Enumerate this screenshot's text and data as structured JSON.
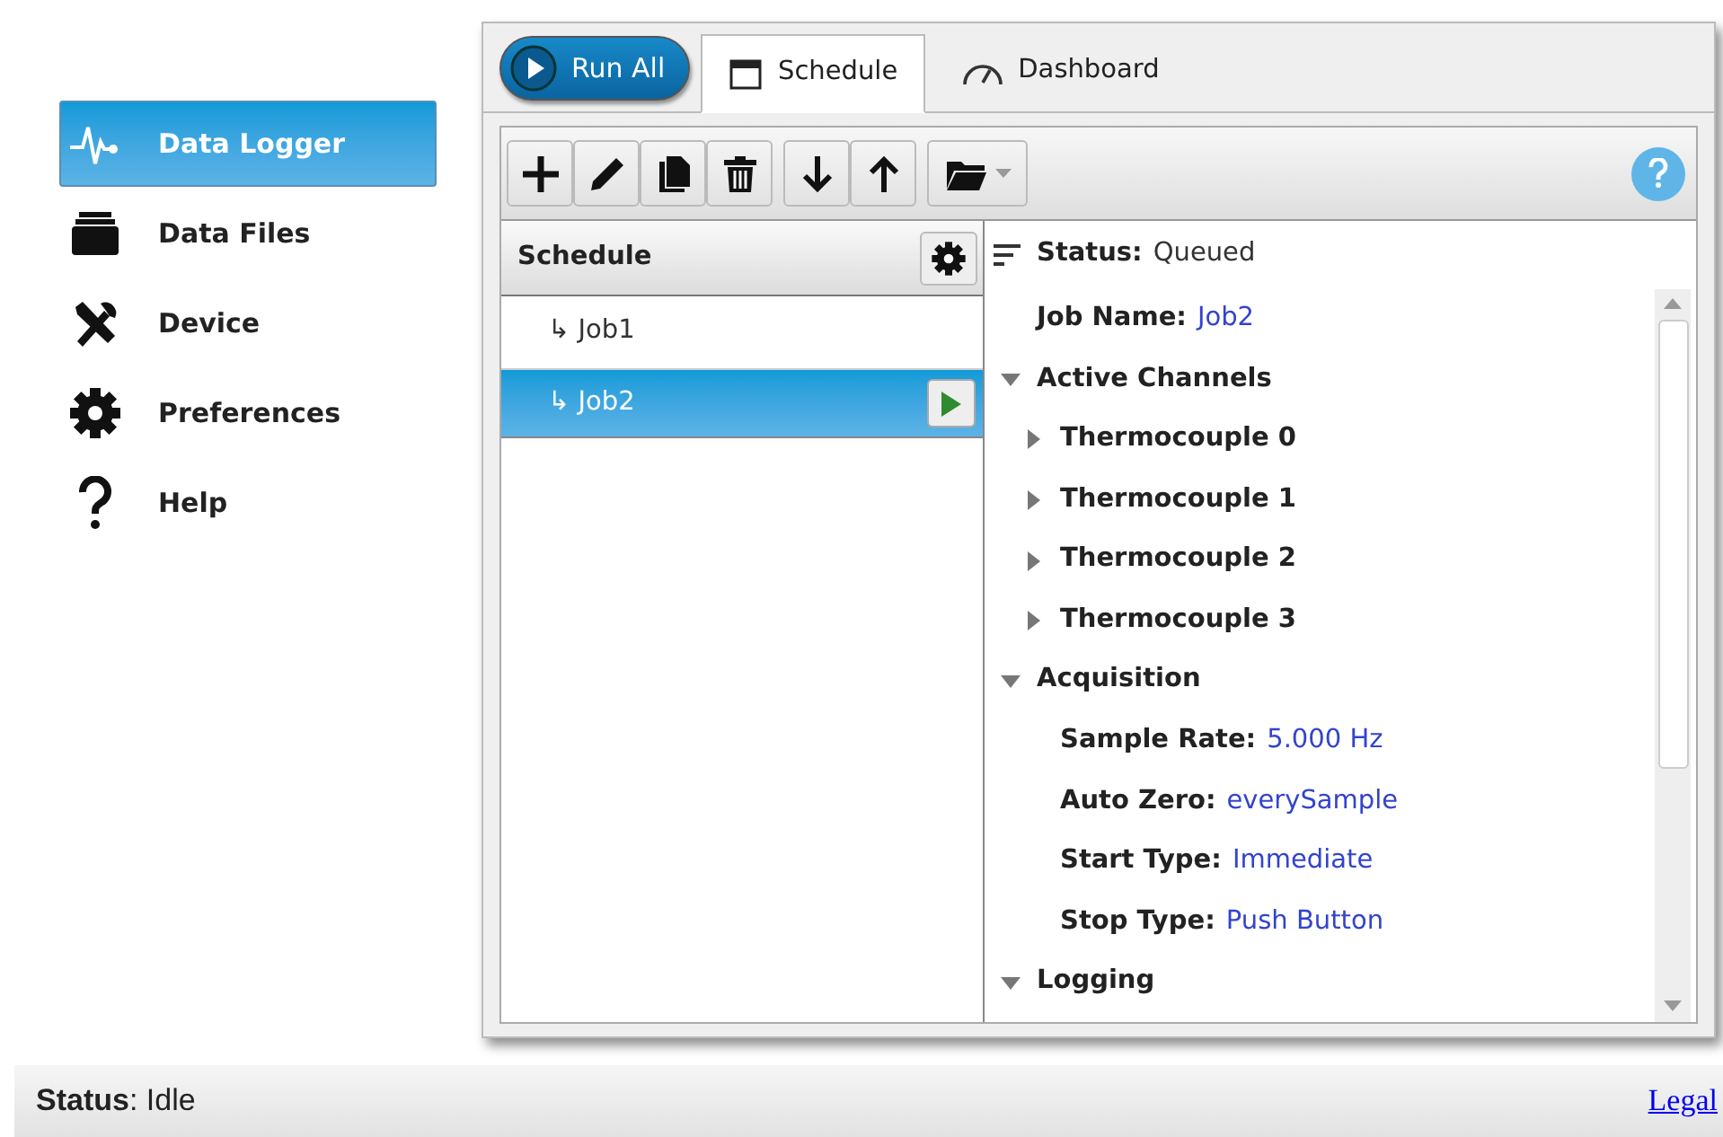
{
  "sidebar": {
    "items": [
      {
        "label": "Data Logger",
        "selected": true
      },
      {
        "label": "Data Files",
        "selected": false
      },
      {
        "label": "Device",
        "selected": false
      },
      {
        "label": "Preferences",
        "selected": false
      },
      {
        "label": "Help",
        "selected": false
      }
    ]
  },
  "run_all": {
    "label": "Run All"
  },
  "tabs": [
    {
      "label": "Schedule",
      "selected": true
    },
    {
      "label": "Dashboard",
      "selected": false
    }
  ],
  "schedule": {
    "title": "Schedule",
    "jobs": [
      {
        "label": "↳ Job1",
        "selected": false
      },
      {
        "label": "↳ Job2",
        "selected": true
      }
    ]
  },
  "details": {
    "status_label": "Status:",
    "status_value": "Queued",
    "items": [
      {
        "kind": "field",
        "label": "Job Name:",
        "value": "Job2"
      },
      {
        "kind": "group",
        "label": "Active Channels",
        "expanded": true,
        "children": [
          {
            "kind": "group",
            "label": "Thermocouple 0",
            "expanded": false
          },
          {
            "kind": "group",
            "label": "Thermocouple 1",
            "expanded": false
          },
          {
            "kind": "group",
            "label": "Thermocouple 2",
            "expanded": false
          },
          {
            "kind": "group",
            "label": "Thermocouple 3",
            "expanded": false
          }
        ]
      },
      {
        "kind": "group",
        "label": "Acquisition",
        "expanded": true,
        "children": [
          {
            "kind": "field",
            "label": "Sample Rate:",
            "value": "5.000 Hz"
          },
          {
            "kind": "field",
            "label": "Auto Zero:",
            "value": "everySample"
          },
          {
            "kind": "field",
            "label": "Start Type:",
            "value": "Immediate"
          },
          {
            "kind": "field",
            "label": "Stop Type:",
            "value": "Push Button"
          }
        ]
      },
      {
        "kind": "group",
        "label": "Logging",
        "expanded": true
      }
    ]
  },
  "status_bar": {
    "label": "Status",
    "value": ": Idle",
    "link": "Legal"
  }
}
